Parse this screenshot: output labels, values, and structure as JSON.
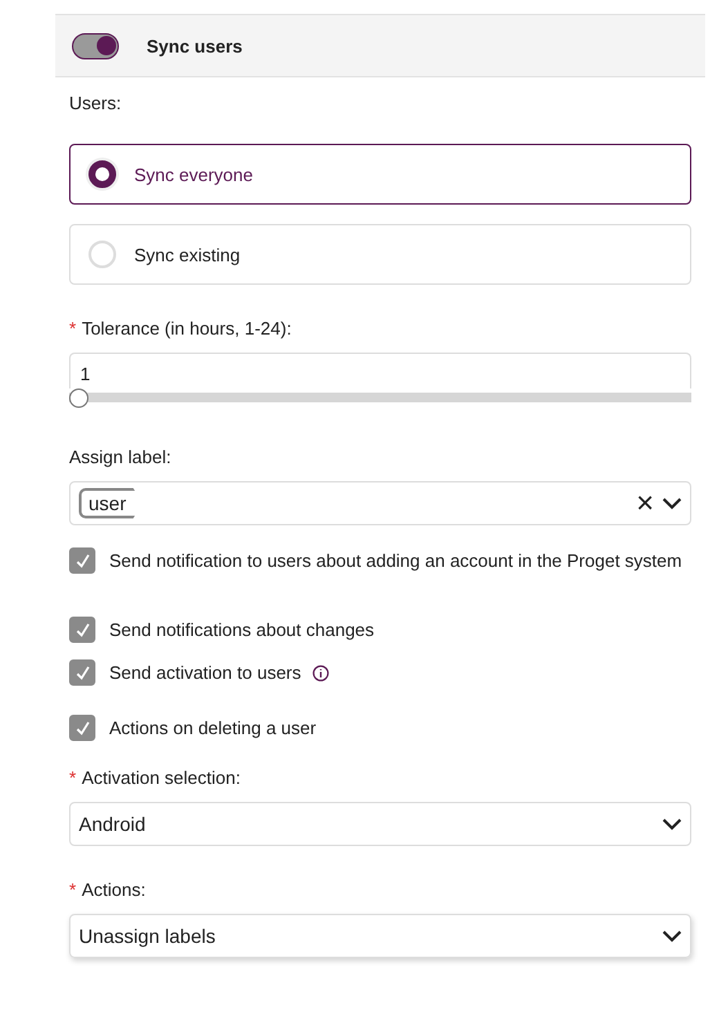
{
  "header": {
    "toggle_on": true,
    "title": "Sync users"
  },
  "users": {
    "label": "Users:",
    "options": [
      {
        "label": "Sync everyone",
        "selected": true
      },
      {
        "label": "Sync existing",
        "selected": false
      }
    ]
  },
  "tolerance": {
    "required_mark": "*",
    "label": "Tolerance (in hours, 1-24):",
    "value": "1",
    "level": 0
  },
  "assign_label": {
    "label": "Assign label:",
    "tags": [
      "user"
    ],
    "clear": "×"
  },
  "checkboxes": [
    {
      "label": "Send notification to users about adding an account in the Proget system",
      "checked": true,
      "info": false
    },
    {
      "label": "Send notifications about changes",
      "checked": true,
      "info": false
    },
    {
      "label": "Send activation to users",
      "checked": true,
      "info": true
    },
    {
      "label": "Actions on deleting a user",
      "checked": true,
      "info": false
    }
  ],
  "activation": {
    "required_mark": "*",
    "label": "Activation selection:",
    "value": "Android"
  },
  "actions": {
    "required_mark": "*",
    "label": "Actions:",
    "value": "Unassign labels"
  }
}
